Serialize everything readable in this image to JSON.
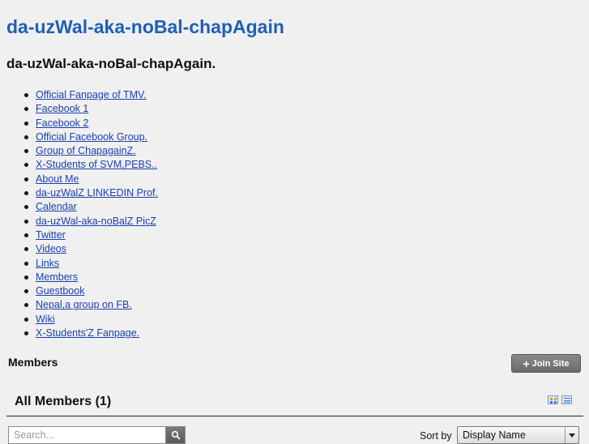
{
  "site": {
    "title": "da-uzWal-aka-noBal-chapAgain"
  },
  "page": {
    "title": "da-uzWal-aka-noBal-chapAgain."
  },
  "nav": {
    "items": [
      {
        "label": "Official Fanpage of TMV."
      },
      {
        "label": "Facebook 1"
      },
      {
        "label": "Facebook 2"
      },
      {
        "label": "Official Facebook Group."
      },
      {
        "label": "Group of ChapagainZ."
      },
      {
        "label": "X-Students of SVM,PEBS.."
      },
      {
        "label": "About Me"
      },
      {
        "label": "da-uzWalZ LINKEDIN Prof."
      },
      {
        "label": "Calendar"
      },
      {
        "label": "da-uzWal-aka-noBalZ PicZ"
      },
      {
        "label": "Twitter"
      },
      {
        "label": "Videos"
      },
      {
        "label": "Links"
      },
      {
        "label": "Members"
      },
      {
        "label": "Guestbook"
      },
      {
        "label": "Nepal,a group on FB."
      },
      {
        "label": "Wiki"
      },
      {
        "label": "X-Students'Z Fanpage."
      }
    ]
  },
  "members": {
    "heading": "Members",
    "join_label": "Join Site",
    "join_icon": "plus-icon",
    "all_members_label": "All Members (1)",
    "view_icons": [
      "grid-view-icon",
      "list-view-icon"
    ]
  },
  "search": {
    "placeholder": "Search...",
    "value": "",
    "icon": "search-icon"
  },
  "sort": {
    "label": "Sort by",
    "selected": "Display Name"
  },
  "colors": {
    "title": "#1f5fb8",
    "link": "#1a3fb0",
    "background": "#f0f0f0",
    "button": "#6a6a6a"
  }
}
